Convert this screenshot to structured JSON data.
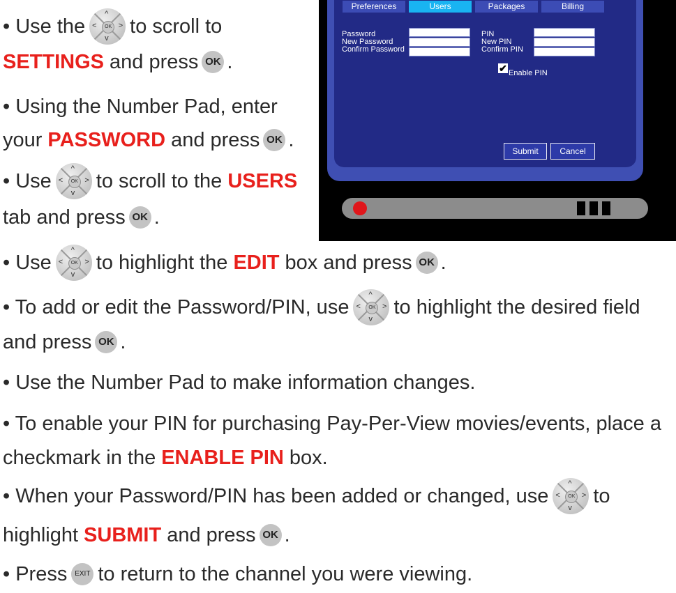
{
  "instructions": {
    "step1": {
      "b1": "• Use the",
      "b2": "to scroll to",
      "key": "SETTINGS",
      "c1": "and press",
      "c2": "."
    },
    "step2": {
      "a": "• Using the Number Pad, enter",
      "b1": "your",
      "key": "PASSWORD",
      "b2": "and press",
      "b3": "."
    },
    "step3": {
      "a1": "• Use",
      "a2": "to scroll to the",
      "key": "USERS",
      "b1": "tab and press",
      "b2": "."
    },
    "step4": {
      "a1": "• Use",
      "a2": "to highlight the",
      "key": "EDIT",
      "a3": "box and press",
      "a4": "."
    },
    "step5": {
      "a1": "• To add or edit the Password/PIN, use",
      "a2": "to highlight the desired field",
      "b1": "and press",
      "b2": "."
    },
    "step6": {
      "a": "• Use the Number Pad to make information changes."
    },
    "step7": {
      "a": "• To enable your PIN for purchasing Pay-Per-View movies/events, place a",
      "b1": "checkmark in the",
      "key": "ENABLE PIN",
      "b2": "box."
    },
    "step8": {
      "a1": "• When your Password/PIN has been added or changed, use",
      "a2": "to",
      "b0": "highlight",
      "key": "SUBMIT",
      "b1": "and press",
      "b2": "."
    },
    "step9": {
      "a1": "• Press",
      "a2": "to return to the channel you were viewing."
    }
  },
  "remote": {
    "ok_label": "OK",
    "exit_label": "EXIT",
    "dpad_center": "OK",
    "up": "^",
    "down": "v",
    "left": "<",
    "right": ">"
  },
  "tv_screen": {
    "tabs": [
      "Preferences",
      "Users",
      "Packages",
      "Billing"
    ],
    "active_tab": "Users",
    "fields_left": [
      "Password",
      "New Password",
      "Confirm Password"
    ],
    "fields_right": [
      "PIN",
      "New PIN",
      "Confirm PIN"
    ],
    "checkbox_label": "Enable PIN",
    "checkbox_checked": true,
    "checkmark": "✔",
    "submit": "Submit",
    "cancel": "Cancel"
  },
  "colors": {
    "highlight": "#e8201c",
    "panel": "#222a86",
    "screen_frame": "#3f4fb3",
    "active_tab": "#19b4f2",
    "tab": "#3c4cb5",
    "led": "#e0161b"
  }
}
